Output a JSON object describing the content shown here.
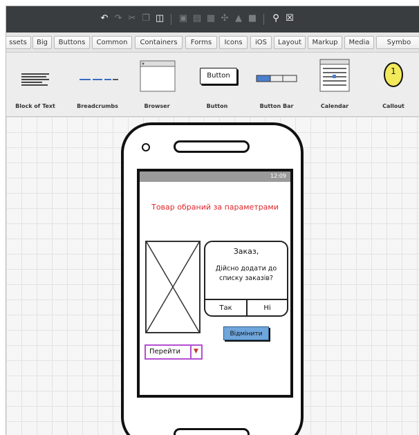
{
  "tabs": [
    "ssets",
    "Big",
    "Buttons",
    "Common",
    "Containers",
    "Forms",
    "Icons",
    "iOS",
    "Layout",
    "Markup",
    "Media",
    "Symbo"
  ],
  "library": {
    "items": [
      {
        "label": "Block of Text"
      },
      {
        "label": "Breadcrumbs"
      },
      {
        "label": "Browser"
      },
      {
        "label": "Button",
        "preview_text": "Button"
      },
      {
        "label": "Button Bar"
      },
      {
        "label": "Calendar"
      },
      {
        "label": "Callout",
        "preview_text": "1"
      }
    ]
  },
  "mockup": {
    "status_time": "12:09",
    "title": "Товар обраний за параметрами",
    "dialog": {
      "title": "Заказ,",
      "message": "Дійсно додати до списку заказів?",
      "yes_label": "Так",
      "no_label": "Ні"
    },
    "cancel_button": "Відмінити",
    "go_button": "Перейти"
  },
  "colors": {
    "title_text": "#e0262a",
    "cancel_button": "#6fa6dc",
    "go_button_border": "#b44fd1",
    "callout_fill": "#f2ea5a"
  }
}
